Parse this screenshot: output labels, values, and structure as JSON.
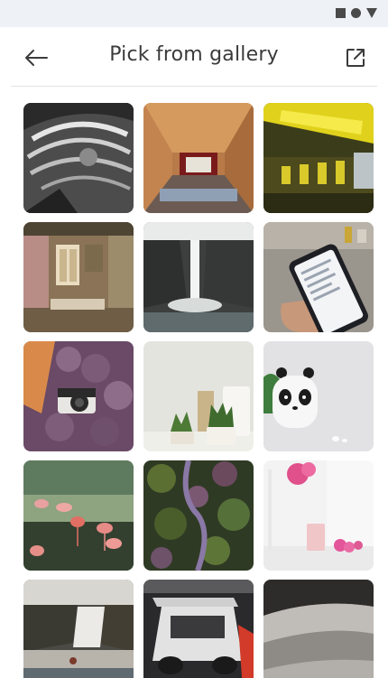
{
  "header": {
    "title": "Pick from gallery",
    "back_icon": "arrow-left-icon",
    "open_icon": "open-external-icon"
  },
  "status_bar": {
    "icons": [
      "square-icon",
      "circle-icon",
      "triangle-icon"
    ]
  },
  "gallery": {
    "photos": [
      {
        "subject": "spiral-architecture-photo"
      },
      {
        "subject": "wooden-tunnel-room-photo"
      },
      {
        "subject": "yellow-lit-corridor-photo"
      },
      {
        "subject": "vintage-interior-room-photo"
      },
      {
        "subject": "waterfall-photo"
      },
      {
        "subject": "phone-in-hand-photo"
      },
      {
        "subject": "camera-on-flowers-photo"
      },
      {
        "subject": "potted-plants-photo"
      },
      {
        "subject": "panda-mug-photo"
      },
      {
        "subject": "flamingos-photo"
      },
      {
        "subject": "aerial-foliage-photo"
      },
      {
        "subject": "pink-flowers-vase-photo"
      },
      {
        "subject": "river-waterfall-photo"
      },
      {
        "subject": "sports-car-photo"
      },
      {
        "subject": "gray-fabric-photo"
      }
    ]
  },
  "colors": {
    "status_bar_bg": "#eef1f5",
    "title_text": "#3b3b3b",
    "divider": "#e3e3e3"
  }
}
